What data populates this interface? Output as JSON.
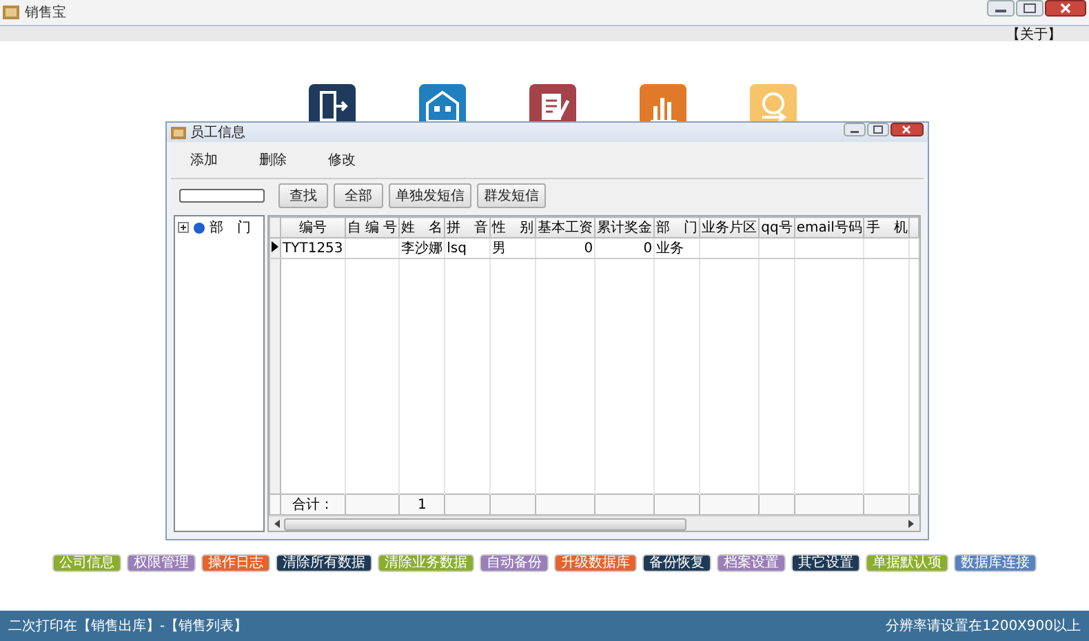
{
  "window": {
    "title": "销售宝"
  },
  "header": {
    "about_link": "【关于】"
  },
  "launcher_icons": [
    {
      "kind": "door",
      "color": "#1f3a5c"
    },
    {
      "kind": "building",
      "color": "#1f7fbf"
    },
    {
      "kind": "document",
      "color": "#a5424a"
    },
    {
      "kind": "chart",
      "color": "#e07a2a"
    },
    {
      "kind": "money",
      "color": "#f7c46a"
    }
  ],
  "dialog": {
    "title": "员工信息",
    "menu": [
      "添加",
      "删除",
      "修改"
    ],
    "buttons": [
      "查找",
      "全部",
      "单独发短信",
      "群发短信"
    ],
    "tree": [
      {
        "label": "部　门",
        "expanded": false
      }
    ],
    "table": {
      "columns": [
        "编号",
        "自 编 号",
        "姓　名",
        "拼　音",
        "性　别",
        "基本工资",
        "累计奖金",
        "部　门",
        "业务片区",
        "qq号",
        "email号码",
        "手　机"
      ],
      "rows": [
        {
          "selected": true,
          "cells": [
            "TYT1253",
            null,
            "李沙娜",
            "lsq",
            "男",
            "0",
            "0",
            "业务",
            null,
            null,
            null,
            null
          ]
        }
      ],
      "footer": {
        "total_label": "合计：",
        "name_total": "1"
      }
    }
  },
  "function_buttons": [
    {
      "label": "公司信息",
      "color": "#8cae2e"
    },
    {
      "label": "权限管理",
      "color": "#9a7fb8"
    },
    {
      "label": "操作日志",
      "color": "#e5642e"
    },
    {
      "label": "清除所有数据",
      "color": "#1f3a55"
    },
    {
      "label": "清除业务数据",
      "color": "#8cae2e"
    },
    {
      "label": "自动备份",
      "color": "#9a7fb8"
    },
    {
      "label": "升级数据库",
      "color": "#e5642e"
    },
    {
      "label": "备份恢复",
      "color": "#1f3a55"
    },
    {
      "label": "档案设置",
      "color": "#9a7fb8"
    },
    {
      "label": "其它设置",
      "color": "#1f3a55"
    },
    {
      "label": "单据默认项",
      "color": "#8cae2e"
    },
    {
      "label": "数据库连接",
      "color": "#5a82c0"
    }
  ],
  "status_bar": {
    "left": "二次打印在【销售出库】-【销售列表】",
    "right": "分辨率请设置在1200X900以上"
  }
}
